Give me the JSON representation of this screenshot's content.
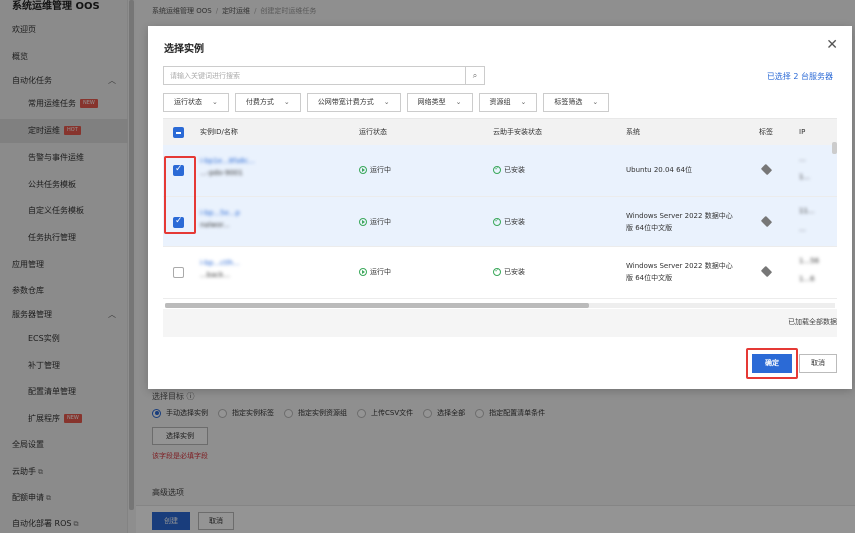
{
  "sidebar": {
    "title": "系统运维管理 OOS",
    "items": [
      {
        "label": "欢迎页"
      },
      {
        "label": "概览"
      },
      {
        "label": "自动化任务"
      },
      {
        "label": "常用运维任务",
        "badge": "NEW"
      },
      {
        "label": "定时运维",
        "badge": "HOT"
      },
      {
        "label": "告警与事件运维"
      },
      {
        "label": "公共任务模板"
      },
      {
        "label": "自定义任务模板"
      },
      {
        "label": "任务执行管理"
      },
      {
        "label": "应用管理"
      },
      {
        "label": "参数仓库"
      },
      {
        "label": "服务器管理"
      },
      {
        "label": "ECS实例"
      },
      {
        "label": "补丁管理"
      },
      {
        "label": "配置清单管理"
      },
      {
        "label": "扩展程序",
        "badge": "NEW"
      },
      {
        "label": "全局设置"
      },
      {
        "label": "云助手"
      },
      {
        "label": "配额申请"
      },
      {
        "label": "自动化部署 ROS"
      }
    ]
  },
  "breadcrumb": [
    "系统运维管理 OOS",
    "定时运维",
    "创建定时运维任务"
  ],
  "main": {
    "target_title": "选择目标",
    "target_options": [
      "手动选择实例",
      "指定实例标签",
      "指定实例资源组",
      "上传CSV文件",
      "选择全部",
      "指定配置清单条件"
    ],
    "select_instance_label": "选择实例",
    "required_error": "该字段是必填字段",
    "advanced_label": "高级选项",
    "create_label": "创建",
    "cancel_label": "取消"
  },
  "modal": {
    "title": "选择实例",
    "search_placeholder": "请输入关键词进行搜索",
    "selected_text": "已选择 2 台服务器",
    "filters": [
      "运行状态",
      "付费方式",
      "公网带宽计费方式",
      "网络类型",
      "资源组",
      "标签筛选"
    ],
    "columns": [
      "实例ID/名称",
      "运行状态",
      "云助手安装状态",
      "系统",
      "标签",
      "IP"
    ],
    "rows": [
      {
        "id": "i-bp1e...8fa8c...",
        "name": "...-pdo-9001",
        "status": "运行中",
        "agent": "已安装",
        "os": "Ubuntu 20.04 64位",
        "os2": "",
        "ip1": "...",
        "ip2": "1...",
        "checked": true
      },
      {
        "id": "i-bp...5e...p",
        "name": "nalwor...",
        "status": "运行中",
        "agent": "已安装",
        "os": "Windows Server 2022 数据中心",
        "os2": "版 64位中文版",
        "ip1": "11...",
        "ip2": "...",
        "checked": true
      },
      {
        "id": "i-bp...ctlh...",
        "name": "...back...",
        "status": "运行中",
        "agent": "已安装",
        "os": "Windows Server 2022 数据中心",
        "os2": "版 64位中文版",
        "ip1": "1...56",
        "ip2": "1...6",
        "checked": false
      }
    ],
    "loaded_text": "已加载全部数据",
    "confirm_label": "确定",
    "cancel_label": "取消"
  },
  "colors": {
    "accent": "#2b6ad6",
    "highlight": "#e53935",
    "status_ok": "#3aa85a",
    "badge": "#e85b4f"
  },
  "icons": [
    "search-icon",
    "close-icon",
    "chevron-down-icon",
    "chevron-up-icon",
    "tag-icon",
    "running-status-icon",
    "installed-check-icon",
    "external-link-icon",
    "help-icon"
  ]
}
